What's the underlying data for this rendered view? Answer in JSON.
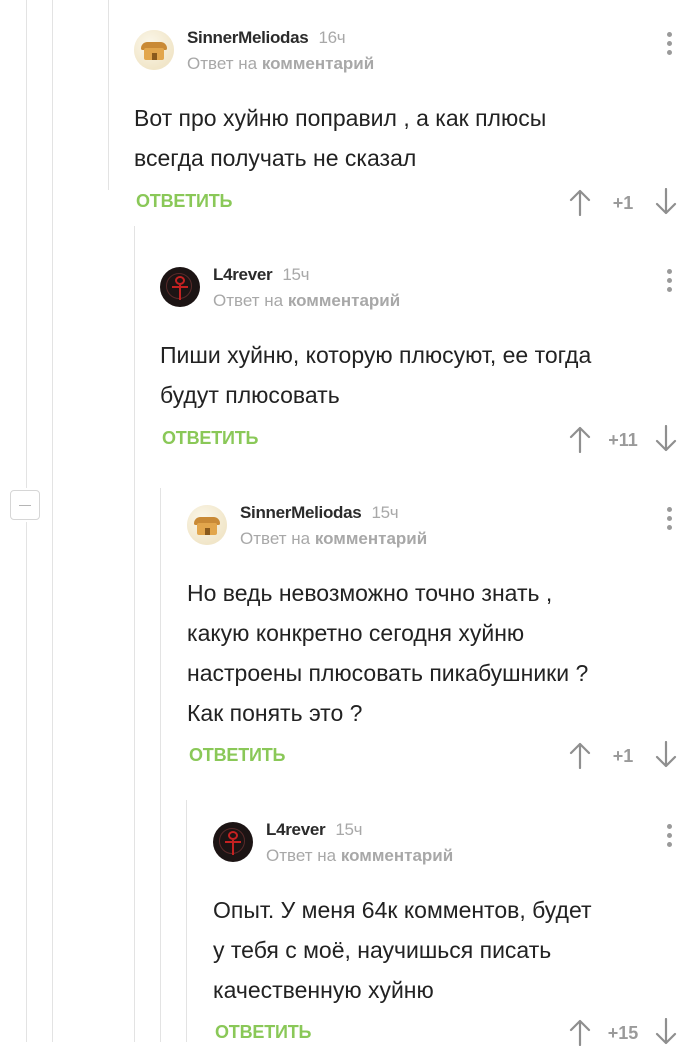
{
  "comments": [
    {
      "author": "SinnerMeliodas",
      "time": "16ч",
      "reply_prefix": "Ответ на",
      "reply_target": "комментарий",
      "avatar": "hut-avatar",
      "text_lines": [
        "Вот про хуйню поправил , а как плюсы",
        "всегда получать не сказал"
      ],
      "reply_label": "ОТВЕТИТЬ",
      "score": "+1"
    },
    {
      "author": "L4rever",
      "time": "15ч",
      "reply_prefix": "Ответ на",
      "reply_target": "комментарий",
      "avatar": "ankh-avatar",
      "text_lines": [
        "Пиши хуйню, которую плюсуют, ее тогда",
        "будут плюсовать"
      ],
      "reply_label": "ОТВЕТИТЬ",
      "score": "+11"
    },
    {
      "author": "SinnerMeliodas",
      "time": "15ч",
      "reply_prefix": "Ответ на",
      "reply_target": "комментарий",
      "avatar": "hut-avatar",
      "text_lines": [
        "Но ведь невозможно точно знать ,",
        "какую конкретно сегодня хуйню",
        "настроены плюсовать пикабушники ?",
        "Как понять это ?"
      ],
      "reply_label": "ОТВЕТИТЬ",
      "score": "+1"
    },
    {
      "author": "L4rever",
      "time": "15ч",
      "reply_prefix": "Ответ на",
      "reply_target": "комментарий",
      "avatar": "ankh-avatar",
      "text_lines": [
        "Опыт. У меня 64к комментов, будет",
        "у тебя с моё, научишься писать",
        "качественную хуйню"
      ],
      "reply_label": "ОТВЕТИТЬ",
      "score": "+15"
    }
  ],
  "colors": {
    "reply_green": "#8ac858",
    "meta_gray": "#a8a8a8",
    "text": "#222222",
    "thread_line": "#e3e3e3"
  },
  "icons": [
    "more-vertical-icon",
    "arrow-up-icon",
    "arrow-down-icon",
    "collapse-minus-icon"
  ]
}
